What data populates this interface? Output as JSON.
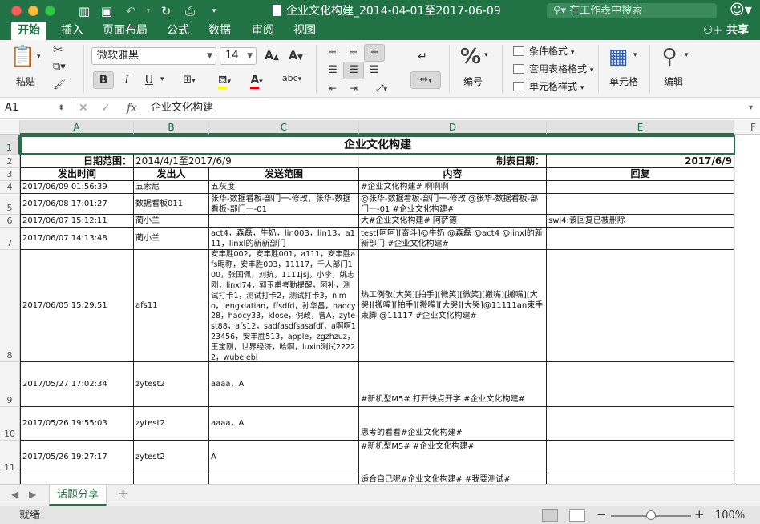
{
  "window": {
    "title": "企业文化构建_2014-04-01至2017-06-09",
    "search_placeholder": "在工作表中搜索"
  },
  "ribbon_tabs": [
    {
      "label": "开始",
      "active": true
    },
    {
      "label": "插入",
      "active": false
    },
    {
      "label": "页面布局",
      "active": false
    },
    {
      "label": "公式",
      "active": false
    },
    {
      "label": "数据",
      "active": false
    },
    {
      "label": "审阅",
      "active": false
    },
    {
      "label": "视图",
      "active": false
    }
  ],
  "share_label": "共享",
  "ribbon": {
    "paste_label": "粘贴",
    "font_name": "微软雅黑",
    "font_size": "14",
    "grow_font": "A",
    "shrink_font": "A",
    "bold": "B",
    "italic": "I",
    "underline": "U",
    "abc": "abc",
    "number_format_symbol": "%",
    "number_label": "编号",
    "conditional_format": "条件格式",
    "table_format": "套用表格格式",
    "cell_style": "单元格样式",
    "cells_label": "单元格",
    "edit_label": "编辑"
  },
  "formula_bar": {
    "name_box": "A1",
    "fx": "fx",
    "value": "企业文化构建"
  },
  "columns": [
    "A",
    "B",
    "C",
    "D",
    "E",
    "F"
  ],
  "rows": [
    "1",
    "2",
    "3",
    "4",
    "5",
    "6",
    "7",
    "8",
    "9",
    "10",
    "11"
  ],
  "sheet": {
    "title": "企业文化构建",
    "date_range_label": "日期范围：",
    "date_range_value": "2014/4/1至2017/6/9",
    "made_date_label": "制表日期：",
    "made_date_value": "2017/6/9",
    "headers": [
      "发出时间",
      "发出人",
      "发送范围",
      "内容",
      "回复"
    ],
    "records": [
      {
        "time": "2017/06/09 01:56:39",
        "sender": "五索尼",
        "scope": "五灰度",
        "content": "#企业文化构建# 啊啊啊",
        "reply": ""
      },
      {
        "time": "2017/06/08 17:01:27",
        "sender": "数据看板011",
        "scope": "张华-数据看板-部门一-修改，张华-数据看板-部门一-01",
        "content": "@张华-数据看板-部门一-修改 @张华-数据看板-部门一-01 #企业文化构建#",
        "reply": ""
      },
      {
        "time": "2017/06/07 15:12:11",
        "sender": "蔺小兰",
        "scope": "",
        "content": "大#企业文化构建# 阿萨德",
        "reply": "swj4:该回复已被删除"
      },
      {
        "time": "2017/06/07 14:13:48",
        "sender": "蔺小兰",
        "scope": "act4，森磊，牛奶，lin003，lin13，a111，linxl的新新部门",
        "content": "test[呵呵][奋斗]@牛奶 @森磊 @act4 @linxl的新新部门 #企业文化构建#",
        "reply": ""
      },
      {
        "time": "2017/06/05 15:29:51",
        "sender": "afs11",
        "scope": "安丰胜002，安丰胜001，a111，安丰胜afs昵称，安丰胜003，11117，千人部门100，张国佩，刘抗，1111jsj，小李，姚志刚，linxl74，郭玉甫考勤提醒，阿补，测试打卡1，测试打卡2，测试打卡3，nimo，lengxiatian，ffsdfd，孙华昌，haocy28，haocy33，klose，倪政，曹A，zytest88，afs12，sadfasdfsasafdf，a啊啊123456，安丰胜513，apple，zgzhzuz，王宝刚，世界经济，哈啊，luxin测试22222，wubeiebi",
        "content": "热工例敬[大哭][拍手][微笑][微笑][搬嘴][搬嘴][大哭][搬嘴][拍手][搬嘴][大哭][大哭]@11111an束手束脚 @11117 #企业文化构建#",
        "reply": ""
      },
      {
        "time": "2017/05/27 17:02:34",
        "sender": "zytest2",
        "scope": "aaaa，A",
        "content": "#新机型M5# 打开快点开学 #企业文化构建#",
        "reply": ""
      },
      {
        "time": "2017/05/26 19:55:03",
        "sender": "zytest2",
        "scope": "aaaa，A",
        "content": "思考的看看#企业文化构建#",
        "reply": ""
      },
      {
        "time": "2017/05/26 19:27:17",
        "sender": "zytest2",
        "scope": "A",
        "content": "#新机型M5# #企业文化构建#",
        "reply": ""
      },
      {
        "time": "",
        "sender": "",
        "scope": "",
        "content": "适合自己呢#企业文化构建# #我要测试#",
        "reply": ""
      }
    ]
  },
  "sheet_tab": "话题分享",
  "status": {
    "text": "就绪",
    "zoom": "100%",
    "zoom_fraction": 0.5
  },
  "colors": {
    "brand": "#217346",
    "title_border": "#217346"
  }
}
